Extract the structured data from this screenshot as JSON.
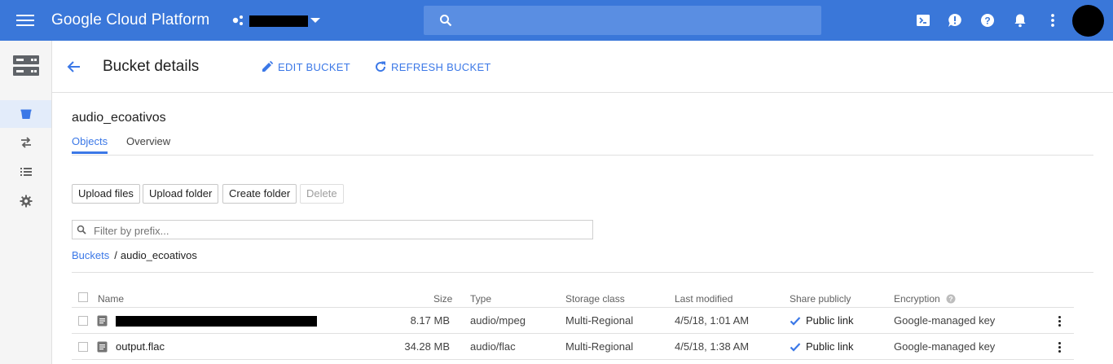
{
  "topbar": {
    "brand": "Google Cloud Platform",
    "search_placeholder": ""
  },
  "header": {
    "title": "Bucket details",
    "edit_label": "EDIT BUCKET",
    "refresh_label": "REFRESH BUCKET"
  },
  "bucket": {
    "name": "audio_ecoativos",
    "tabs": [
      "Objects",
      "Overview"
    ]
  },
  "actions": {
    "upload_files": "Upload files",
    "upload_folder": "Upload folder",
    "create_folder": "Create folder",
    "delete": "Delete"
  },
  "filter": {
    "placeholder": "Filter by prefix..."
  },
  "breadcrumb": {
    "root": "Buckets",
    "separator": "/",
    "current": "audio_ecoativos"
  },
  "table": {
    "columns": [
      "Name",
      "Size",
      "Type",
      "Storage class",
      "Last modified",
      "Share publicly",
      "Encryption"
    ],
    "rows": [
      {
        "name": "",
        "size": "8.17 MB",
        "type": "audio/mpeg",
        "storage_class": "Multi-Regional",
        "last_modified": "4/5/18, 1:01 AM",
        "share": "Public link",
        "encryption": "Google-managed key"
      },
      {
        "name": "output.flac",
        "size": "34.28 MB",
        "type": "audio/flac",
        "storage_class": "Multi-Regional",
        "last_modified": "4/5/18, 1:38 AM",
        "share": "Public link",
        "encryption": "Google-managed key"
      }
    ]
  },
  "colors": {
    "topbar": "#3a77d9",
    "accent": "#3b78e7",
    "search": "#5a8ee2"
  },
  "icons": [
    "menu-icon",
    "project-icon",
    "search-icon",
    "cloud-shell-icon",
    "feedback-icon",
    "help-icon",
    "notifications-icon",
    "more-vert-icon",
    "storage-icon",
    "bucket-icon",
    "transfer-icon",
    "transfer-appliance-icon",
    "settings-icon",
    "back-arrow-icon",
    "edit-icon",
    "refresh-icon",
    "file-icon",
    "check-icon",
    "info-icon"
  ]
}
